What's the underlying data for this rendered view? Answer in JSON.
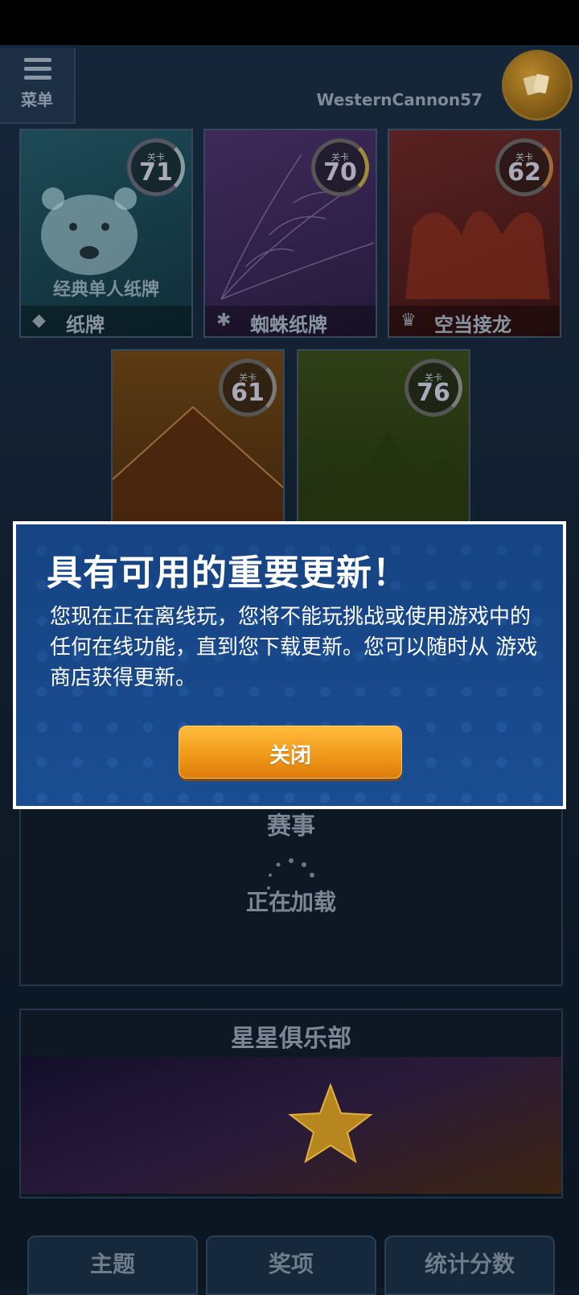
{
  "header": {
    "menu_label": "菜单",
    "username": "WesternCannon57"
  },
  "games": [
    {
      "level_label": "关卡",
      "level": "71",
      "subtitle": "经典单人纸牌",
      "name": "纸牌",
      "icon": "polar-bear-icon"
    },
    {
      "level_label": "关卡",
      "level": "70",
      "subtitle": "",
      "name": "蜘蛛纸牌",
      "icon": "spider-web-icon"
    },
    {
      "level_label": "关卡",
      "level": "62",
      "subtitle": "",
      "name": "空当接龙",
      "icon": "crown-icon"
    },
    {
      "level_label": "关卡",
      "level": "61",
      "subtitle": "",
      "name": "",
      "icon": "pyramid-icon"
    },
    {
      "level_label": "关卡",
      "level": "76",
      "subtitle": "",
      "name": "",
      "icon": "mountain-icon"
    }
  ],
  "events": {
    "title": "赛事",
    "loading": "正在加载"
  },
  "star_club": {
    "title": "星星俱乐部"
  },
  "bottom_tabs": [
    "主题",
    "奖项",
    "统计分数"
  ],
  "dialog": {
    "title": "具有可用的重要更新！",
    "body": "您现在正在离线玩，您将不能玩挑战或使用游戏中的任何在线功能，直到您下载更新。您可以随时从 游戏商店获得更新。",
    "close_label": "关闭"
  },
  "colors": {
    "dialog_bg": "#1d4f93",
    "button_orange": "#f29a1a"
  }
}
